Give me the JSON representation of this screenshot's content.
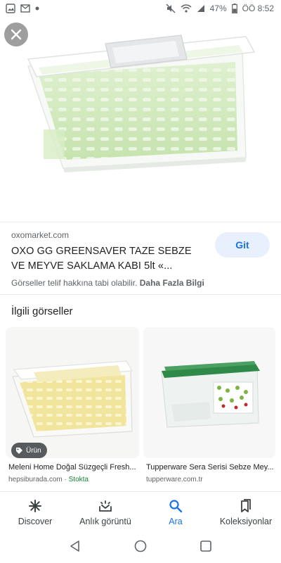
{
  "status_bar": {
    "battery": "47%",
    "time": "ÖÖ 8:52"
  },
  "viewer": {
    "close_label": "close",
    "source_domain": "oxomarket.com",
    "title": "OXO GG GREENSAVER TAZE SEBZE VE MEYVE SAKLAMA KABI 5lt «...",
    "visit_button": "Git",
    "copyright_text": "Görseller telif hakkına tabi olabilir.",
    "more_info": "Daha Fazla Bilgi"
  },
  "related": {
    "heading": "İlgili görseller",
    "cards": [
      {
        "title": "Meleni Home Doğal Süzgeçli Fresh...",
        "source": "hepsiburada.com",
        "separator": "·",
        "stock": "Stokta",
        "badge": "Ürün"
      },
      {
        "title": "Tupperware Sera Serisi Sebze Mey...",
        "source": "tupperware.com.tr"
      }
    ]
  },
  "bottom_nav": [
    {
      "label": "Discover",
      "icon": "asterisk-icon"
    },
    {
      "label": "Anlık görüntü",
      "icon": "snapshot-icon"
    },
    {
      "label": "Ara",
      "icon": "search-icon",
      "active": true
    },
    {
      "label": "Koleksiyonlar",
      "icon": "collections-icon"
    }
  ],
  "colors": {
    "accent": "#1a73e8",
    "stock_green": "#188038",
    "git_bg": "#e8f0fe"
  }
}
